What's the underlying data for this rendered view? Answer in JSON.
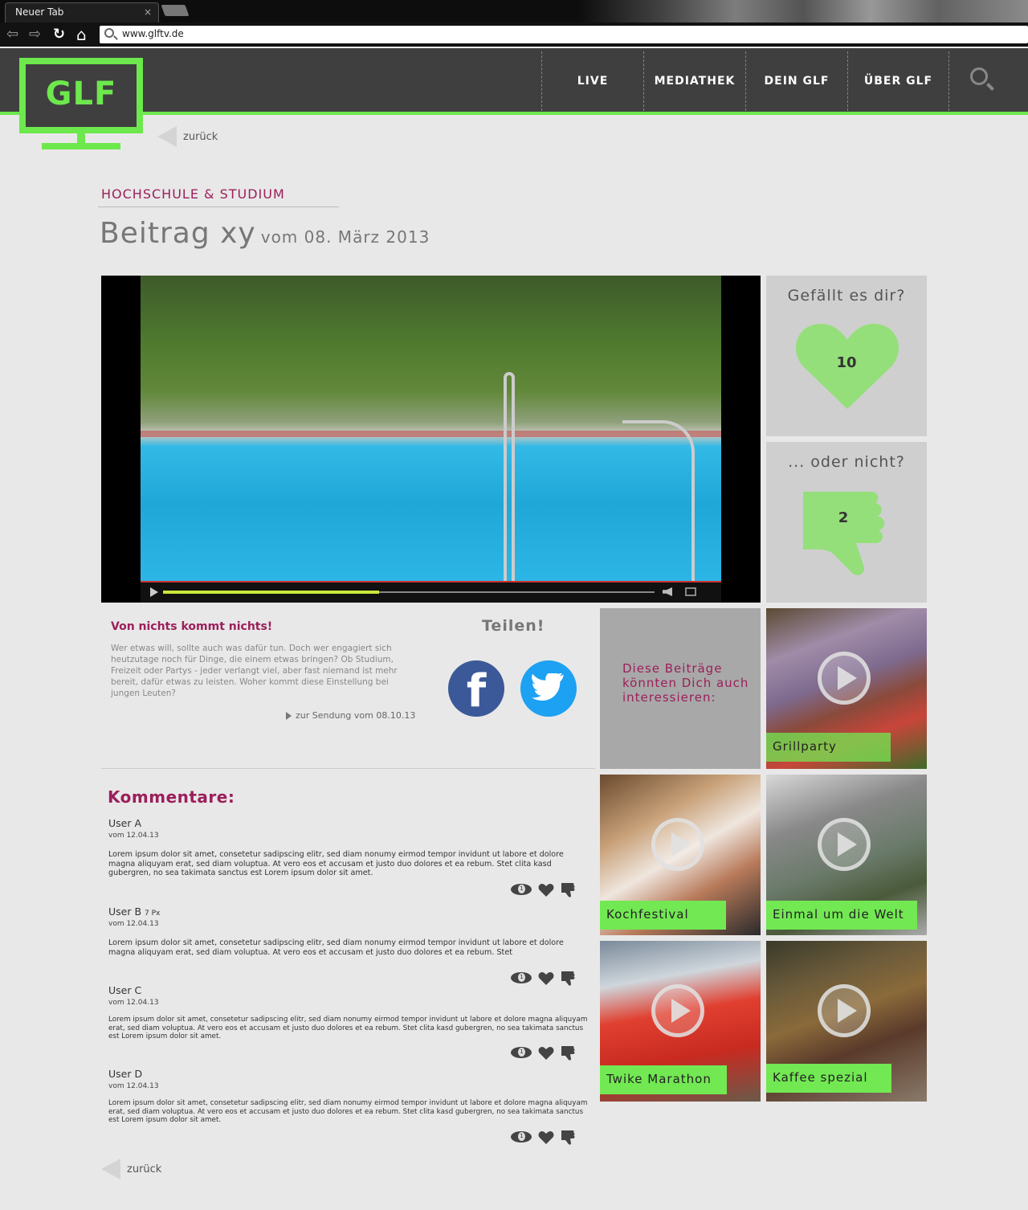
{
  "browser": {
    "tab_title": "Neuer Tab",
    "tab_close": "×",
    "url": "www.glftv.de",
    "back_glyph": "⇦",
    "forward_glyph": "⇨",
    "reload_glyph": "↻",
    "home_glyph": "⌂"
  },
  "site": {
    "logo": "GLF",
    "nav": [
      "LIVE",
      "MEDIATHEK",
      "DEIN GLF",
      "ÜBER GLF"
    ],
    "accent_color": "#6de84d",
    "brand_color": "#9b1f5a"
  },
  "back_label": "zurück",
  "article": {
    "category": "HOCHSCHULE & STUDIUM",
    "title": "Beitrag xy",
    "date": "vom 08. März 2013",
    "video_progress_percent": 44
  },
  "likes": {
    "like_question": "Gefällt es dir?",
    "like_count": "10",
    "dislike_question": "... oder nicht?",
    "dislike_count": "2"
  },
  "description": {
    "title": "Von nichts kommt nichts!",
    "text": "Wer etwas will, sollte auch was dafür tun. Doch wer engagiert sich heutzutage noch für Dinge, die einem etwas bringen? Ob Studium, Freizeit oder Partys - jeder verlangt viel, aber fast niemand ist mehr bereit, dafür etwas zu leisten. Woher kommt diese Einstellung bei jungen Leuten?",
    "link": "zur Sendung vom 08.10.13"
  },
  "share": {
    "title": "Teilen!",
    "facebook_glyph": "f"
  },
  "recommendations": {
    "intro": "Diese Beiträge könnten Dich auch interessieren:",
    "items": [
      "Grillparty",
      "Kochfestival",
      "Einmal um die Welt",
      "Twike Marathon",
      "Kaffee spezial"
    ]
  },
  "comments": {
    "title": "Kommentare:",
    "items": [
      {
        "user": "User A",
        "px": "",
        "date": "vom 12.04.13",
        "views": "1",
        "text": "Lorem ipsum dolor sit amet, consetetur sadipscing elitr, sed diam nonumy eirmod tempor invidunt ut labore et dolore magna aliquyam erat, sed diam voluptua. At vero eos et accusam et justo duo dolores et ea rebum. Stet clita kasd gubergren, no sea takimata sanctus est Lorem ipsum dolor sit amet."
      },
      {
        "user": "User B",
        "px": "7 Px",
        "date": "vom 12.04.13",
        "views": "1",
        "text": "Lorem ipsum dolor sit amet, consetetur sadipscing elitr, sed diam nonumy eirmod tempor invidunt ut labore et dolore magna aliquyam erat, sed diam voluptua. At vero eos et accusam et justo duo dolores et ea rebum. Stet"
      },
      {
        "user": "User C",
        "px": "",
        "date": "vom 12.04.13",
        "views": "1",
        "text": "Lorem ipsum dolor sit amet, consetetur sadipscing elitr, sed diam nonumy eirmod tempor invidunt ut labore et dolore magna aliquyam erat, sed diam voluptua. At vero eos et accusam et justo duo dolores et ea rebum. Stet clita kasd gubergren, no sea takimata sanctus est Lorem ipsum dolor sit amet."
      },
      {
        "user": "User D",
        "px": "",
        "date": "vom 12.04.13",
        "views": "1",
        "text": "Lorem ipsum dolor sit amet, consetetur sadipscing elitr, sed diam nonumy eirmod tempor invidunt ut labore et dolore magna aliquyam erat, sed diam voluptua. At vero eos et accusam et justo duo dolores et ea rebum. Stet clita kasd gubergren, no sea takimata sanctus est Lorem ipsum dolor sit amet."
      }
    ]
  }
}
